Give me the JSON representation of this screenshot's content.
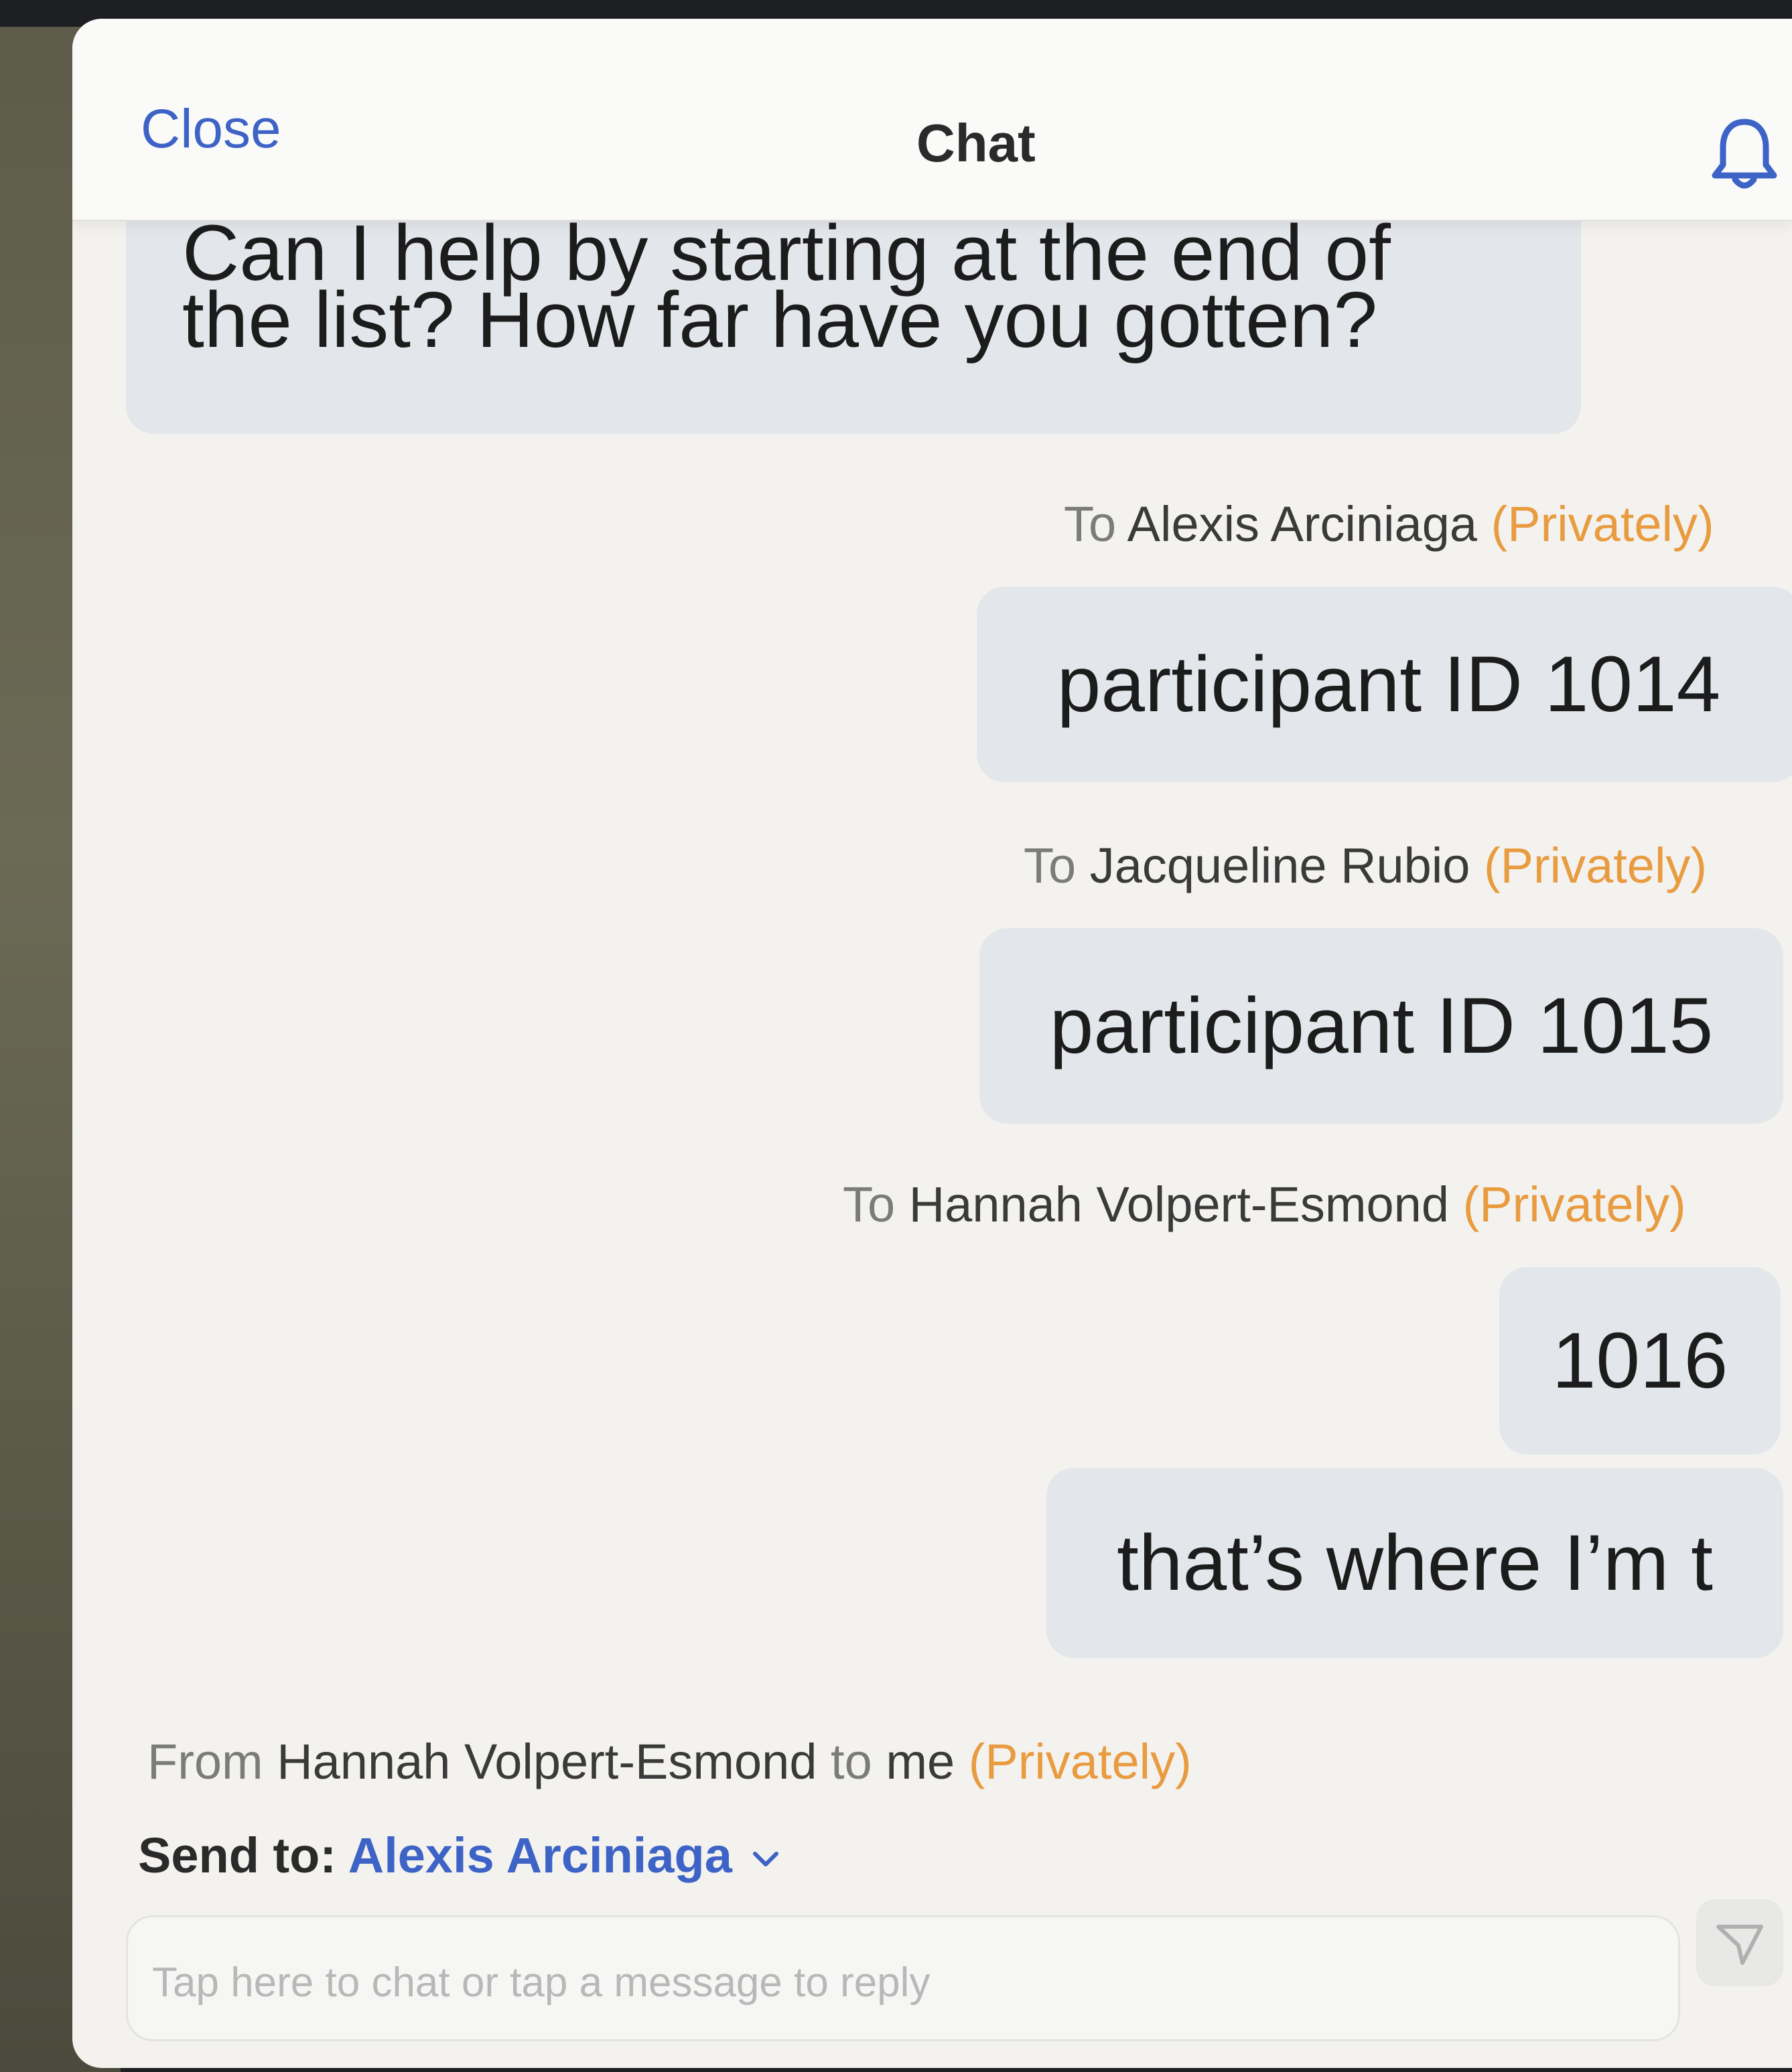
{
  "header": {
    "close_label": "Close",
    "title": "Chat",
    "bell_icon": "bell-icon"
  },
  "messages": [
    {
      "text_clipped": "Can I help by starting at the end of",
      "text": "the list? How far have you gotten?"
    },
    {
      "meta_prefix": "To ",
      "recipient": "Alexis Arciniaga",
      "privacy": "(Privately)",
      "text": "participant ID 1014"
    },
    {
      "meta_prefix": "To ",
      "recipient": "Jacqueline Rubio",
      "privacy": "(Privately)",
      "text": "participant ID 1015"
    },
    {
      "meta_prefix": "To ",
      "recipient": "Hannah Volpert-Esmond",
      "privacy": "(Privately)",
      "text": "1016"
    },
    {
      "text": "that’s where I’m t"
    }
  ],
  "incoming_meta": {
    "from_prefix": "From ",
    "sender": "Hannah Volpert-Esmond",
    "to_text": " to ",
    "me": "me",
    "privacy": "(Privately)"
  },
  "composer": {
    "send_to_label": "Send to: ",
    "recipient": "Alexis Arciniaga",
    "placeholder": "Tap here to chat or tap a message to reply",
    "send_icon": "send-icon"
  },
  "colors": {
    "link_blue": "#3e63c6",
    "private_orange": "#e99b40",
    "bubble": "#e3e6ea",
    "panel": "#f3f2ef"
  }
}
